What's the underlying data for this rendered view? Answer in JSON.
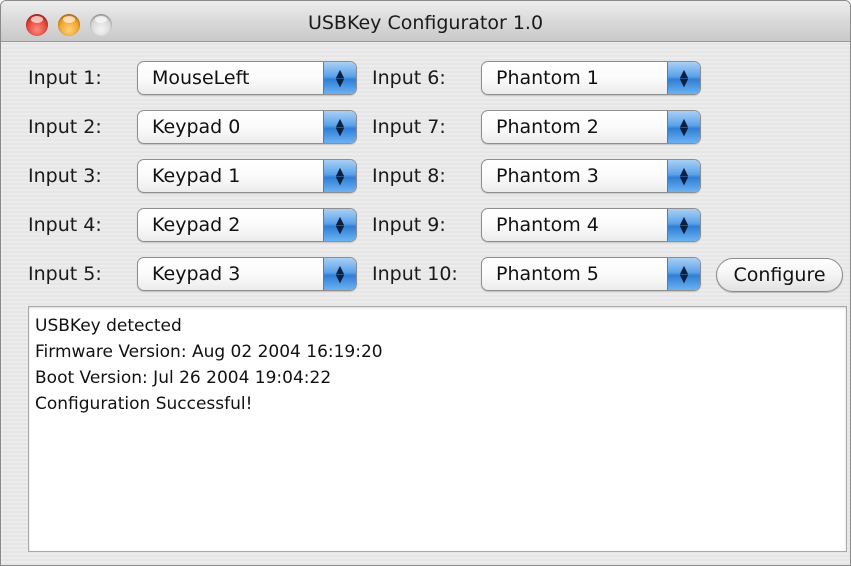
{
  "window": {
    "title": "USBKey Configurator 1.0"
  },
  "inputs": [
    {
      "label": "Input 1:",
      "value": "MouseLeft"
    },
    {
      "label": "Input 2:",
      "value": "Keypad 0"
    },
    {
      "label": "Input 3:",
      "value": "Keypad 1"
    },
    {
      "label": "Input 4:",
      "value": "Keypad 2"
    },
    {
      "label": "Input 5:",
      "value": "Keypad 3"
    },
    {
      "label": "Input 6:",
      "value": "Phantom 1"
    },
    {
      "label": "Input 7:",
      "value": "Phantom 2"
    },
    {
      "label": "Input 8:",
      "value": "Phantom 3"
    },
    {
      "label": "Input 9:",
      "value": "Phantom 4"
    },
    {
      "label": "Input 10:",
      "value": "Phantom 5"
    }
  ],
  "configure_button": {
    "label": "Configure"
  },
  "log": {
    "lines": [
      "USBKey detected",
      "Firmware Version: Aug 02 2004 16:19:20",
      "Boot Version: Jul 26 2004 19:04:22",
      "Configuration Successful!"
    ]
  },
  "icons": {
    "close": "close-icon",
    "minimize": "minimize-icon",
    "zoom": "zoom-icon",
    "popup_arrows": "updown-arrows-icon"
  },
  "colors": {
    "close": "#e0443a",
    "minimize": "#f2a02a",
    "zoom": "#d6d6d6",
    "popup_accent": "#2f7fd6"
  }
}
